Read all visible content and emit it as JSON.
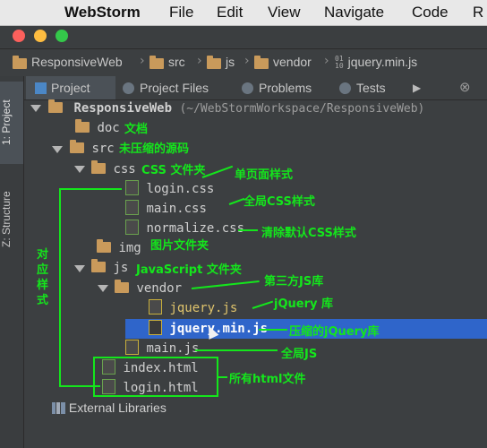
{
  "menubar": {
    "apple": "",
    "app": "WebStorm",
    "items": [
      "File",
      "Edit",
      "View",
      "Navigate",
      "Code",
      "R"
    ]
  },
  "breadcrumb": [
    "ResponsiveWeb",
    "src",
    "js",
    "vendor",
    "jquery.min.js"
  ],
  "side_tabs": [
    "1: Project",
    "Z: Structure"
  ],
  "tool_tabs": [
    "Project",
    "Project Files",
    "Problems",
    "Tests"
  ],
  "tree": {
    "root": "ResponsiveWeb",
    "root_path": "(~/WebStormWorkspace/ResponsiveWeb)",
    "doc": "doc",
    "src": "src",
    "css": "css",
    "login_css": "login.css",
    "main_css": "main.css",
    "normalize_css": "normalize.css",
    "img": "img",
    "js": "js",
    "vendor": "vendor",
    "jquery_js": "jquery.js",
    "jquery_min_js": "jquery.min.js",
    "main_js": "main.js",
    "index_html": "index.html",
    "login_html": "login.html",
    "external": "External Libraries"
  },
  "annotations": {
    "doc": "文档",
    "src": "未压缩的源码",
    "css": "CSS 文件夹",
    "login_css": "单页面样式",
    "main_css": "全局CSS样式",
    "normalize_css": "清除默认CSS样式",
    "img": "图片文件夹",
    "js": "JavaScript 文件夹",
    "vendor": "第三方JS库",
    "jquery_js": "jQuery 库",
    "jquery_min_js": "压缩的jQuery库",
    "main_js": "全局JS",
    "html": "所有html文件",
    "side": [
      "对",
      "应",
      "样",
      "式"
    ]
  },
  "colors": {
    "annotation": "#14e61c",
    "selection": "#2f65ca",
    "background": "#3c3f41"
  }
}
